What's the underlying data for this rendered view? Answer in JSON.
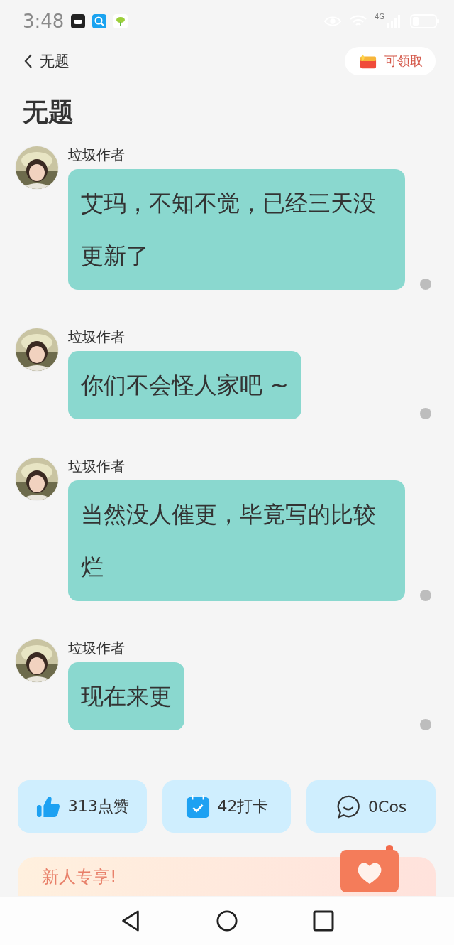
{
  "status_bar": {
    "time": "3:48",
    "network": "4G"
  },
  "header": {
    "back_label": "无题",
    "reward_button": "可领取"
  },
  "title": "无题",
  "messages": [
    {
      "author": "垃圾作者",
      "text": "艾玛，不知不觉，已经三天没更新了"
    },
    {
      "author": "垃圾作者",
      "text": "你们不会怪人家吧 ~"
    },
    {
      "author": "垃圾作者",
      "text": "当然没人催更，毕竟写的比较烂"
    },
    {
      "author": "垃圾作者",
      "text": "现在来更"
    }
  ],
  "stats": [
    {
      "kind": "like",
      "label": "313点赞"
    },
    {
      "kind": "checkin",
      "label": "42打卡"
    },
    {
      "kind": "comment",
      "label": "0Cos"
    }
  ],
  "banner": {
    "text": "新人专享!"
  }
}
